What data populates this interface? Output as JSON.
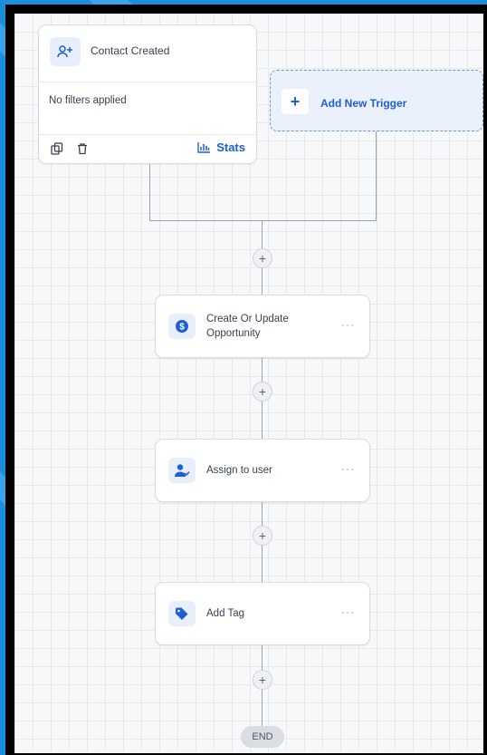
{
  "trigger": {
    "title": "Contact Created",
    "filter_text": "No filters applied",
    "stats_label": "Stats",
    "icon": "user-plus-icon"
  },
  "add_trigger": {
    "label": "Add New Trigger",
    "plus": "+"
  },
  "actions": [
    {
      "title_line1": "Create Or Update",
      "title_line2": "Opportunity",
      "icon": "dollar-circle-icon",
      "more": "···"
    },
    {
      "title": "Assign to user",
      "icon": "user-assign-icon",
      "more": "···"
    },
    {
      "title": "Add Tag",
      "icon": "tag-icon",
      "more": "···"
    }
  ],
  "add_node_symbol": "+",
  "end_label": "END",
  "colors": {
    "accent": "#1e5fd6",
    "icon_bg": "#e8effb",
    "connector": "#9aa3ad"
  }
}
